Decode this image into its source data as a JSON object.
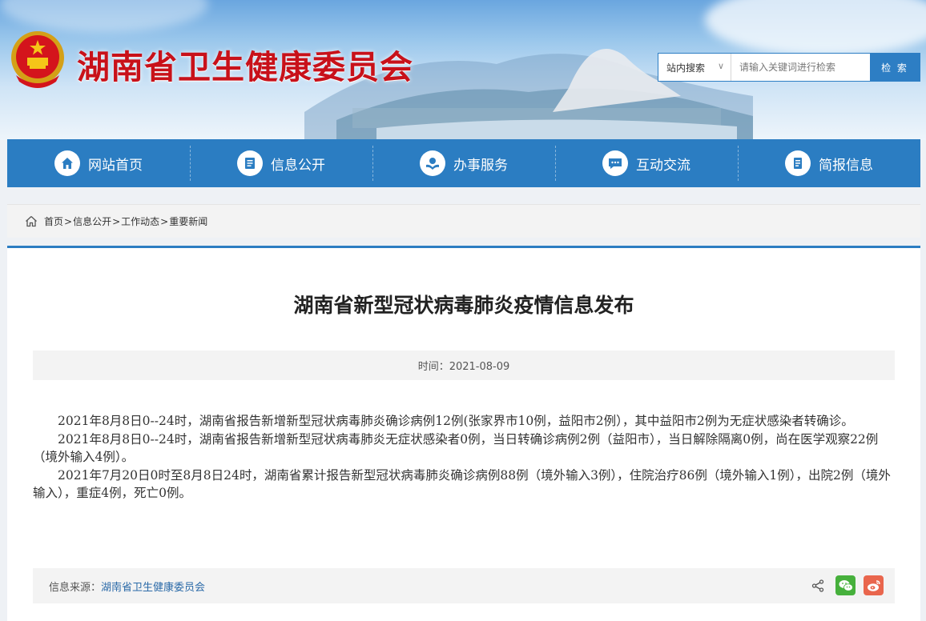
{
  "site": {
    "title": "湖南省卫生健康委员会"
  },
  "search": {
    "scope": "站内搜索",
    "placeholder": "请输入关键词进行检索",
    "button": "检 索"
  },
  "nav": [
    {
      "label": "网站首页",
      "icon": "home-icon"
    },
    {
      "label": "信息公开",
      "icon": "document-icon"
    },
    {
      "label": "办事服务",
      "icon": "service-icon"
    },
    {
      "label": "互动交流",
      "icon": "chat-icon"
    },
    {
      "label": "简报信息",
      "icon": "briefing-icon"
    }
  ],
  "breadcrumb": [
    "首页",
    "信息公开",
    "工作动态",
    "重要新闻"
  ],
  "article": {
    "title": "湖南省新型冠状病毒肺炎疫情信息发布",
    "time": "时间：2021-08-09",
    "paragraphs": [
      "2021年8月8日0--24时，湖南省报告新增新型冠状病毒肺炎确诊病例12例(张家界市10例，益阳市2例），其中益阳市2例为无症状感染者转确诊。",
      "2021年8月8日0--24时，湖南省报告新增新型冠状病毒肺炎无症状感染者0例，当日转确诊病例2例（益阳市），当日解除隔离0例，尚在医学观察22例（境外输入4例）。",
      "2021年7月20日0时至8月8日24时，湖南省累计报告新型冠状病毒肺炎确诊病例88例（境外输入3例），住院治疗86例（境外输入1例），出院2例（境外输入），重症4例，死亡0例。"
    ],
    "source_label": "信息来源：",
    "source_name": "湖南省卫生健康委员会"
  },
  "share": [
    "share-icon",
    "wechat-icon",
    "weibo-icon"
  ],
  "colors": {
    "brand_red": "#c8111a",
    "nav_blue": "#2b7dc2"
  }
}
